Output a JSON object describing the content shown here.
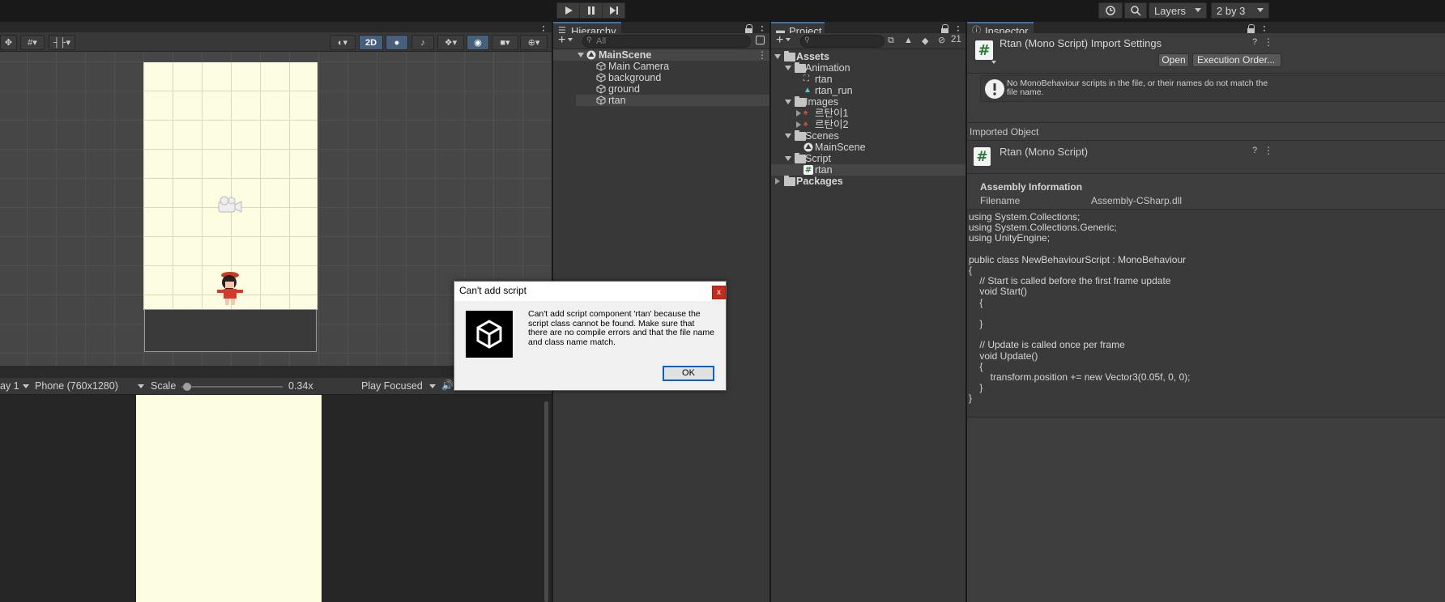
{
  "toolbar": {
    "play_icon": "play-icon",
    "pause_icon": "pause-icon",
    "step_icon": "step-icon",
    "layers_label": "Layers",
    "layout_label": "2 by 3"
  },
  "scene": {
    "toggle_2d": "2D"
  },
  "game": {
    "display_label": "ay 1",
    "resolution_label": "Phone (760x1280)",
    "scale_label": "Scale",
    "scale_value": "0.34x",
    "scale_fraction": 0.02,
    "play_mode_label": "Play Focused"
  },
  "hierarchy": {
    "tab_label": "Hierarchy",
    "search_placeholder": "All",
    "scene_name": "MainScene",
    "items": [
      {
        "label": "Main Camera"
      },
      {
        "label": "background"
      },
      {
        "label": "ground"
      },
      {
        "label": "rtan"
      }
    ]
  },
  "project": {
    "tab_label": "Project",
    "hidden_count": "21",
    "assets_label": "Assets",
    "animation_folder": "Animation",
    "animation_items": [
      "rtan",
      "rtan_run"
    ],
    "images_folder": "Images",
    "images_items": [
      "르탄이1",
      "르탄이2"
    ],
    "scenes_folder": "Scenes",
    "scenes_items": [
      "MainScene"
    ],
    "script_folder": "Script",
    "script_items": [
      "rtan"
    ],
    "packages_label": "Packages"
  },
  "inspector": {
    "tab_label": "Inspector",
    "title": "Rtan (Mono Script) Import Settings",
    "open_button": "Open",
    "execution_order_button": "Execution Order...",
    "warning_text": "No MonoBehaviour scripts in the file, or their names do not match the file name.",
    "imported_object_label": "Imported Object",
    "object_title": "Rtan (Mono Script)",
    "assembly_heading": "Assembly Information",
    "filename_label": "Filename",
    "filename_value": "Assembly-CSharp.dll",
    "code_lines": [
      "using System.Collections;",
      "using System.Collections.Generic;",
      "using UnityEngine;",
      "",
      "public class NewBehaviourScript : MonoBehaviour",
      "{",
      "    // Start is called before the first frame update",
      "    void Start()",
      "    {",
      "",
      "    }",
      "",
      "    // Update is called once per frame",
      "    void Update()",
      "    {",
      "        transform.position += new Vector3(0.05f, 0, 0);",
      "    }",
      "}"
    ]
  },
  "dialog": {
    "title": "Can't add script",
    "close_label": "x",
    "message": "Can't add script component 'rtan' because the script class cannot be found. Make sure that there are no compile errors and that the file name and class name match.",
    "ok_label": "OK"
  }
}
